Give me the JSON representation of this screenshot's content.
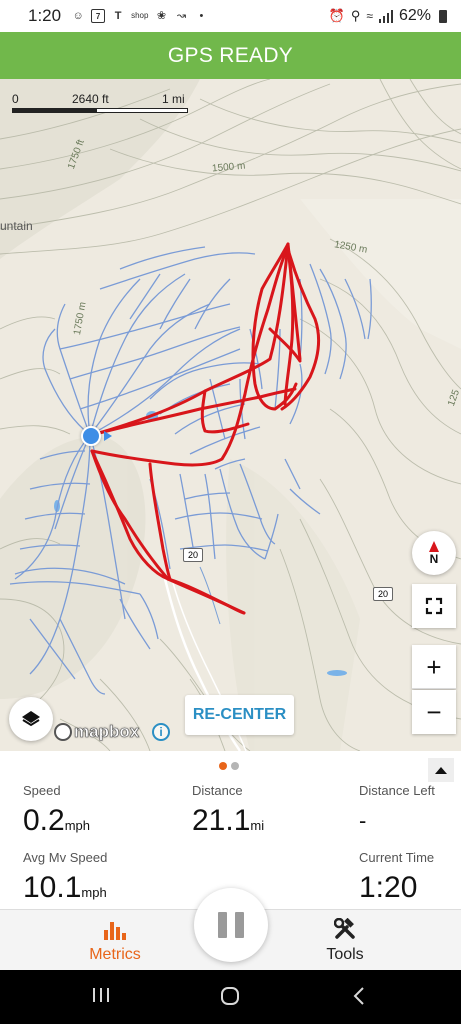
{
  "status_bar": {
    "time": "1:20",
    "left_icons": [
      "snapchat-icon",
      "calendar-icon",
      "tesla-icon",
      "shop-icon",
      "fan-icon",
      "skier-icon",
      "dot-icon"
    ],
    "calendar_day": "7",
    "shop_text": "shop",
    "battery": "62%"
  },
  "header": {
    "title": "GPS READY",
    "bg_color": "#71b84b"
  },
  "map": {
    "scale": {
      "zero": "0",
      "mid": "2640 ft",
      "end": "1 mi"
    },
    "contour_labels": [
      "1750 ft",
      "1500 m",
      "1250 m",
      "1750 m",
      "125"
    ],
    "place_label": "untain",
    "road_labels": [
      "20",
      "20"
    ],
    "compass_label": "N",
    "recenter_label": "RE-CENTER",
    "attribution": "mapbox",
    "track_color": "#d8161b",
    "trail_color": "#7a9bd6"
  },
  "metrics": {
    "page_indicator": {
      "active_color": "#e8651a",
      "inactive_color": "#b5b5b5"
    },
    "speed": {
      "label": "Speed",
      "value": "0.2",
      "unit": "mph"
    },
    "distance": {
      "label": "Distance",
      "value": "21.1",
      "unit": "mi"
    },
    "distance_left": {
      "label": "Distance Left",
      "value": "-"
    },
    "avg_speed": {
      "label": "Avg Mv Speed",
      "value": "10.1",
      "unit": "mph"
    },
    "current_time": {
      "label": "Current Time",
      "value": "1:20"
    }
  },
  "tabs": {
    "metrics": {
      "label": "Metrics",
      "color": "#e8651a"
    },
    "tools": {
      "label": "Tools",
      "color": "#222222"
    }
  }
}
